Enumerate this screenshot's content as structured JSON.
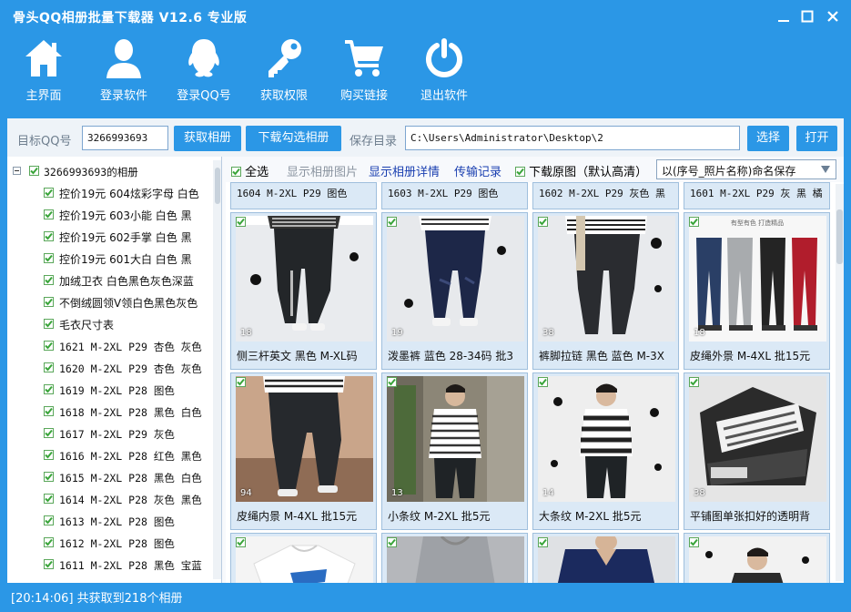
{
  "window": {
    "title": "骨头QQ相册批量下载器 V12.6 专业版"
  },
  "toolbar": {
    "items": [
      {
        "label": "主界面",
        "icon": "home-icon"
      },
      {
        "label": "登录软件",
        "icon": "user-icon"
      },
      {
        "label": "登录QQ号",
        "icon": "qq-penguin-icon"
      },
      {
        "label": "获取权限",
        "icon": "key-icon"
      },
      {
        "label": "购买链接",
        "icon": "cart-icon"
      },
      {
        "label": "退出软件",
        "icon": "power-icon"
      }
    ]
  },
  "topbar": {
    "qq_label": "目标QQ号",
    "qq_value": "3266993693",
    "fetch_button": "获取相册",
    "download_button": "下载勾选相册",
    "save_label": "保存目录",
    "save_path": "C:\\Users\\Administrator\\Desktop\\2",
    "choose_button": "选择",
    "open_button": "打开"
  },
  "tree": {
    "root": "3266993693的相册",
    "items": [
      "控价19元 604炫彩字母 白色",
      "控价19元 603小能 白色 黑",
      "控价19元 602手掌 白色 黑",
      "控价19元 601大白 白色 黑",
      "加绒卫衣 白色黑色灰色深蓝",
      "不倒绒圆领V领白色黑色灰色",
      "毛衣尺寸表",
      "1621 M-2XL P29 杏色 灰色",
      "1620 M-2XL P29 杏色 灰色",
      "1619 M-2XL P28 图色",
      "1618 M-2XL P28 黑色 白色",
      "1617 M-2XL P29 灰色",
      "1616 M-2XL P28 红色 黑色",
      "1615 M-2XL P28 黑色 白色",
      "1614 M-2XL P28 灰色 黑色",
      "1613 M-2XL P28 图色",
      "1612 M-2XL P28 图色",
      "1611 M-2XL P28 黑色 宝蓝"
    ]
  },
  "options": {
    "select_all": "全选",
    "show_images": "显示相册图片",
    "show_details": "显示相册详情",
    "transfer_log": "传输记录",
    "download_original": "下载原图（默认高清）",
    "naming_select": "以(序号_照片名称)命名保存"
  },
  "grid": {
    "top_row": [
      "1604 M-2XL P29 图色",
      "1603 M-2XL P29 图色",
      "1602 M-2XL P29 灰色 黑",
      "1601 M-2XL P29 灰 黑 橘"
    ],
    "cards": [
      {
        "caption": "侧三杆英文 黑色 M-XL码",
        "count": "18"
      },
      {
        "caption": "泼墨裤 蓝色 28-34码 批3",
        "count": "19"
      },
      {
        "caption": "裤脚拉链 黑色 蓝色 M-3X",
        "count": "38"
      },
      {
        "caption": "皮绳外景 M-4XL 批15元",
        "count": "18"
      },
      {
        "caption": "皮绳内景 M-4XL 批15元",
        "count": "94"
      },
      {
        "caption": "小条纹 M-2XL 批5元",
        "count": "13"
      },
      {
        "caption": "大条纹 M-2XL 批5元",
        "count": "14"
      },
      {
        "caption": "平铺图单张扣好的透明背",
        "count": "38"
      }
    ],
    "thumb_banner": "有型有色 打造精品"
  },
  "status": {
    "text": "[20:14:06] 共获取到218个相册"
  },
  "colors": {
    "brand": "#2b97e6",
    "check": "#3aa53a",
    "link": "#1a3fb0"
  }
}
